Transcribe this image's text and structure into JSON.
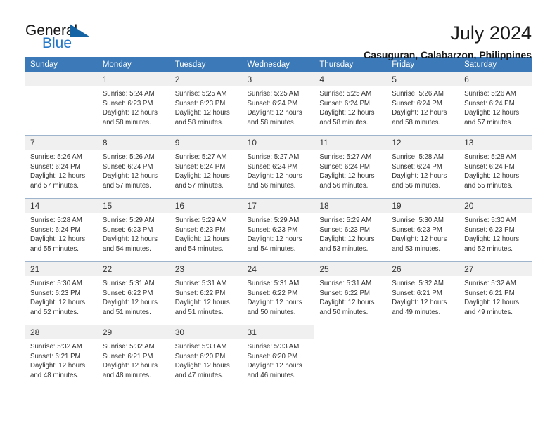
{
  "brand": {
    "name_part1": "General",
    "name_part2": "Blue",
    "triangle_color": "#1464a5",
    "blue_color": "#2277c8"
  },
  "header": {
    "title": "July 2024",
    "subtitle": "Casuguran, Calabarzon, Philippines"
  },
  "theme": {
    "header_row_bg": "#3b79b8",
    "daynum_bg": "#f0f0f0",
    "grid_line": "#9db4cc",
    "text": "#333333"
  },
  "weekdays": [
    "Sunday",
    "Monday",
    "Tuesday",
    "Wednesday",
    "Thursday",
    "Friday",
    "Saturday"
  ],
  "weeks": [
    [
      {
        "day": "",
        "lines": []
      },
      {
        "day": "1",
        "lines": [
          "Sunrise: 5:24 AM",
          "Sunset: 6:23 PM",
          "Daylight: 12 hours",
          "and 58 minutes."
        ]
      },
      {
        "day": "2",
        "lines": [
          "Sunrise: 5:25 AM",
          "Sunset: 6:23 PM",
          "Daylight: 12 hours",
          "and 58 minutes."
        ]
      },
      {
        "day": "3",
        "lines": [
          "Sunrise: 5:25 AM",
          "Sunset: 6:24 PM",
          "Daylight: 12 hours",
          "and 58 minutes."
        ]
      },
      {
        "day": "4",
        "lines": [
          "Sunrise: 5:25 AM",
          "Sunset: 6:24 PM",
          "Daylight: 12 hours",
          "and 58 minutes."
        ]
      },
      {
        "day": "5",
        "lines": [
          "Sunrise: 5:26 AM",
          "Sunset: 6:24 PM",
          "Daylight: 12 hours",
          "and 58 minutes."
        ]
      },
      {
        "day": "6",
        "lines": [
          "Sunrise: 5:26 AM",
          "Sunset: 6:24 PM",
          "Daylight: 12 hours",
          "and 57 minutes."
        ]
      }
    ],
    [
      {
        "day": "7",
        "lines": [
          "Sunrise: 5:26 AM",
          "Sunset: 6:24 PM",
          "Daylight: 12 hours",
          "and 57 minutes."
        ]
      },
      {
        "day": "8",
        "lines": [
          "Sunrise: 5:26 AM",
          "Sunset: 6:24 PM",
          "Daylight: 12 hours",
          "and 57 minutes."
        ]
      },
      {
        "day": "9",
        "lines": [
          "Sunrise: 5:27 AM",
          "Sunset: 6:24 PM",
          "Daylight: 12 hours",
          "and 57 minutes."
        ]
      },
      {
        "day": "10",
        "lines": [
          "Sunrise: 5:27 AM",
          "Sunset: 6:24 PM",
          "Daylight: 12 hours",
          "and 56 minutes."
        ]
      },
      {
        "day": "11",
        "lines": [
          "Sunrise: 5:27 AM",
          "Sunset: 6:24 PM",
          "Daylight: 12 hours",
          "and 56 minutes."
        ]
      },
      {
        "day": "12",
        "lines": [
          "Sunrise: 5:28 AM",
          "Sunset: 6:24 PM",
          "Daylight: 12 hours",
          "and 56 minutes."
        ]
      },
      {
        "day": "13",
        "lines": [
          "Sunrise: 5:28 AM",
          "Sunset: 6:24 PM",
          "Daylight: 12 hours",
          "and 55 minutes."
        ]
      }
    ],
    [
      {
        "day": "14",
        "lines": [
          "Sunrise: 5:28 AM",
          "Sunset: 6:24 PM",
          "Daylight: 12 hours",
          "and 55 minutes."
        ]
      },
      {
        "day": "15",
        "lines": [
          "Sunrise: 5:29 AM",
          "Sunset: 6:23 PM",
          "Daylight: 12 hours",
          "and 54 minutes."
        ]
      },
      {
        "day": "16",
        "lines": [
          "Sunrise: 5:29 AM",
          "Sunset: 6:23 PM",
          "Daylight: 12 hours",
          "and 54 minutes."
        ]
      },
      {
        "day": "17",
        "lines": [
          "Sunrise: 5:29 AM",
          "Sunset: 6:23 PM",
          "Daylight: 12 hours",
          "and 54 minutes."
        ]
      },
      {
        "day": "18",
        "lines": [
          "Sunrise: 5:29 AM",
          "Sunset: 6:23 PM",
          "Daylight: 12 hours",
          "and 53 minutes."
        ]
      },
      {
        "day": "19",
        "lines": [
          "Sunrise: 5:30 AM",
          "Sunset: 6:23 PM",
          "Daylight: 12 hours",
          "and 53 minutes."
        ]
      },
      {
        "day": "20",
        "lines": [
          "Sunrise: 5:30 AM",
          "Sunset: 6:23 PM",
          "Daylight: 12 hours",
          "and 52 minutes."
        ]
      }
    ],
    [
      {
        "day": "21",
        "lines": [
          "Sunrise: 5:30 AM",
          "Sunset: 6:23 PM",
          "Daylight: 12 hours",
          "and 52 minutes."
        ]
      },
      {
        "day": "22",
        "lines": [
          "Sunrise: 5:31 AM",
          "Sunset: 6:22 PM",
          "Daylight: 12 hours",
          "and 51 minutes."
        ]
      },
      {
        "day": "23",
        "lines": [
          "Sunrise: 5:31 AM",
          "Sunset: 6:22 PM",
          "Daylight: 12 hours",
          "and 51 minutes."
        ]
      },
      {
        "day": "24",
        "lines": [
          "Sunrise: 5:31 AM",
          "Sunset: 6:22 PM",
          "Daylight: 12 hours",
          "and 50 minutes."
        ]
      },
      {
        "day": "25",
        "lines": [
          "Sunrise: 5:31 AM",
          "Sunset: 6:22 PM",
          "Daylight: 12 hours",
          "and 50 minutes."
        ]
      },
      {
        "day": "26",
        "lines": [
          "Sunrise: 5:32 AM",
          "Sunset: 6:21 PM",
          "Daylight: 12 hours",
          "and 49 minutes."
        ]
      },
      {
        "day": "27",
        "lines": [
          "Sunrise: 5:32 AM",
          "Sunset: 6:21 PM",
          "Daylight: 12 hours",
          "and 49 minutes."
        ]
      }
    ],
    [
      {
        "day": "28",
        "lines": [
          "Sunrise: 5:32 AM",
          "Sunset: 6:21 PM",
          "Daylight: 12 hours",
          "and 48 minutes."
        ]
      },
      {
        "day": "29",
        "lines": [
          "Sunrise: 5:32 AM",
          "Sunset: 6:21 PM",
          "Daylight: 12 hours",
          "and 48 minutes."
        ]
      },
      {
        "day": "30",
        "lines": [
          "Sunrise: 5:33 AM",
          "Sunset: 6:20 PM",
          "Daylight: 12 hours",
          "and 47 minutes."
        ]
      },
      {
        "day": "31",
        "lines": [
          "Sunrise: 5:33 AM",
          "Sunset: 6:20 PM",
          "Daylight: 12 hours",
          "and 46 minutes."
        ]
      },
      {
        "day": "",
        "lines": []
      },
      {
        "day": "",
        "lines": []
      },
      {
        "day": "",
        "lines": []
      }
    ]
  ]
}
